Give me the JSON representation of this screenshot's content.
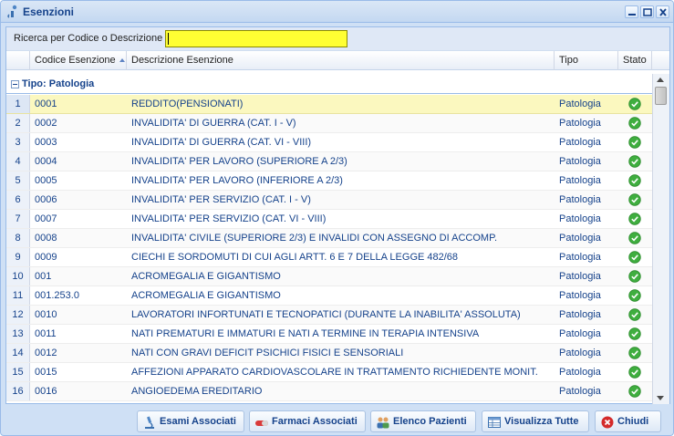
{
  "window": {
    "title": "Esenzioni"
  },
  "search": {
    "label": "Ricerca per Codice o Descrizione",
    "value": ""
  },
  "columns": {
    "code": "Codice Esenzione",
    "description": "Descrizione Esenzione",
    "type": "Tipo",
    "status": "Stato"
  },
  "group": {
    "label": "Tipo: Patologia"
  },
  "rows": [
    {
      "n": "1",
      "code": "0001",
      "desc": "REDDITO(PENSIONATI)",
      "type": "Patologia"
    },
    {
      "n": "2",
      "code": "0002",
      "desc": "INVALIDITA' DI GUERRA (CAT. I - V)",
      "type": "Patologia"
    },
    {
      "n": "3",
      "code": "0003",
      "desc": "INVALIDITA' DI GUERRA (CAT. VI - VIII)",
      "type": "Patologia"
    },
    {
      "n": "4",
      "code": "0004",
      "desc": "INVALIDITA' PER LAVORO (SUPERIORE A 2/3)",
      "type": "Patologia"
    },
    {
      "n": "5",
      "code": "0005",
      "desc": "INVALIDITA' PER LAVORO (INFERIORE A 2/3)",
      "type": "Patologia"
    },
    {
      "n": "6",
      "code": "0006",
      "desc": "INVALIDITA' PER SERVIZIO (CAT. I - V)",
      "type": "Patologia"
    },
    {
      "n": "7",
      "code": "0007",
      "desc": "INVALIDITA' PER SERVIZIO (CAT. VI - VIII)",
      "type": "Patologia"
    },
    {
      "n": "8",
      "code": "0008",
      "desc": "INVALIDITA' CIVILE (SUPERIORE 2/3) E INVALIDI CON ASSEGNO DI ACCOMP.",
      "type": "Patologia"
    },
    {
      "n": "9",
      "code": "0009",
      "desc": "CIECHI E SORDOMUTI DI CUI AGLI ARTT. 6 E 7 DELLA LEGGE 482/68",
      "type": "Patologia"
    },
    {
      "n": "10",
      "code": "001",
      "desc": "ACROMEGALIA E GIGANTISMO",
      "type": "Patologia"
    },
    {
      "n": "11",
      "code": "001.253.0",
      "desc": "ACROMEGALIA E GIGANTISMO",
      "type": "Patologia"
    },
    {
      "n": "12",
      "code": "0010",
      "desc": "LAVORATORI INFORTUNATI E TECNOPATICI (DURANTE LA INABILITA' ASSOLUTA)",
      "type": "Patologia"
    },
    {
      "n": "13",
      "code": "0011",
      "desc": "NATI PREMATURI E IMMATURI E NATI A TERMINE IN TERAPIA INTENSIVA",
      "type": "Patologia"
    },
    {
      "n": "14",
      "code": "0012",
      "desc": "NATI CON GRAVI DEFICIT PSICHICI FISICI E SENSORIALI",
      "type": "Patologia"
    },
    {
      "n": "15",
      "code": "0015",
      "desc": "AFFEZIONI APPARATO CARDIOVASCOLARE IN TRATTAMENTO RICHIEDENTE MONIT.",
      "type": "Patologia"
    },
    {
      "n": "16",
      "code": "0016",
      "desc": "ANGIOEDEMA EREDITARIO",
      "type": "Patologia"
    }
  ],
  "footer": {
    "exams": "Esami Associati",
    "drugs": "Farmaci Associati",
    "patients": "Elenco Pazienti",
    "view_all": "Visualizza Tutte",
    "close": "Chiudi"
  },
  "colors": {
    "accent": "#15428b",
    "search_bg": "#ffff33",
    "selected_row": "#fbf8bf",
    "status_ok": "#3fae3f"
  }
}
